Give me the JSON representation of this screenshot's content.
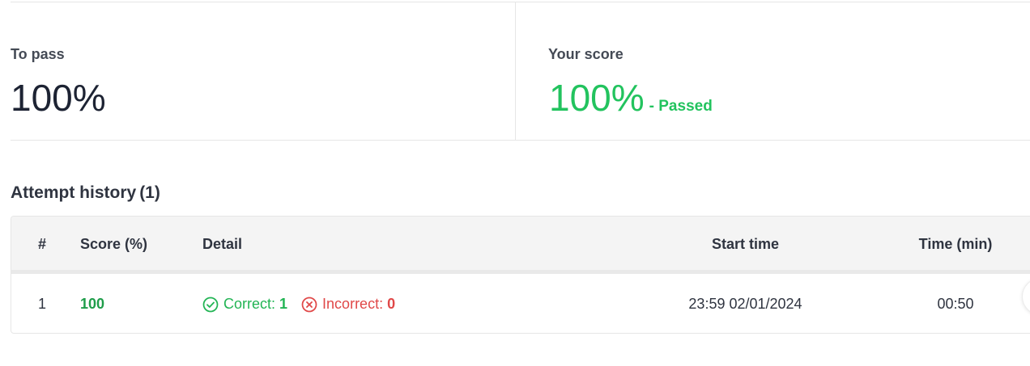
{
  "summary": {
    "pass": {
      "label": "To pass",
      "value": "100%"
    },
    "score": {
      "label": "Your score",
      "value": "100%",
      "status": "- Passed"
    }
  },
  "history": {
    "title": "Attempt history",
    "count": "(1)",
    "columns": {
      "index": "#",
      "score": "Score (%)",
      "detail": "Detail",
      "start_time": "Start time",
      "time_min": "Time (min)"
    },
    "rows": [
      {
        "index": "1",
        "score": "100",
        "correct_label": "Correct:",
        "correct_value": "1",
        "incorrect_label": "Incorrect:",
        "incorrect_value": "0",
        "start_time": "23:59 02/01/2024",
        "duration": "00:50"
      }
    ]
  },
  "colors": {
    "pass_green": "#22c35e",
    "correct_green": "#22b454",
    "incorrect_red": "#e04848",
    "text_dark": "#1d2333"
  },
  "icons": {
    "correct": "check-circle-icon",
    "incorrect": "x-circle-icon"
  }
}
